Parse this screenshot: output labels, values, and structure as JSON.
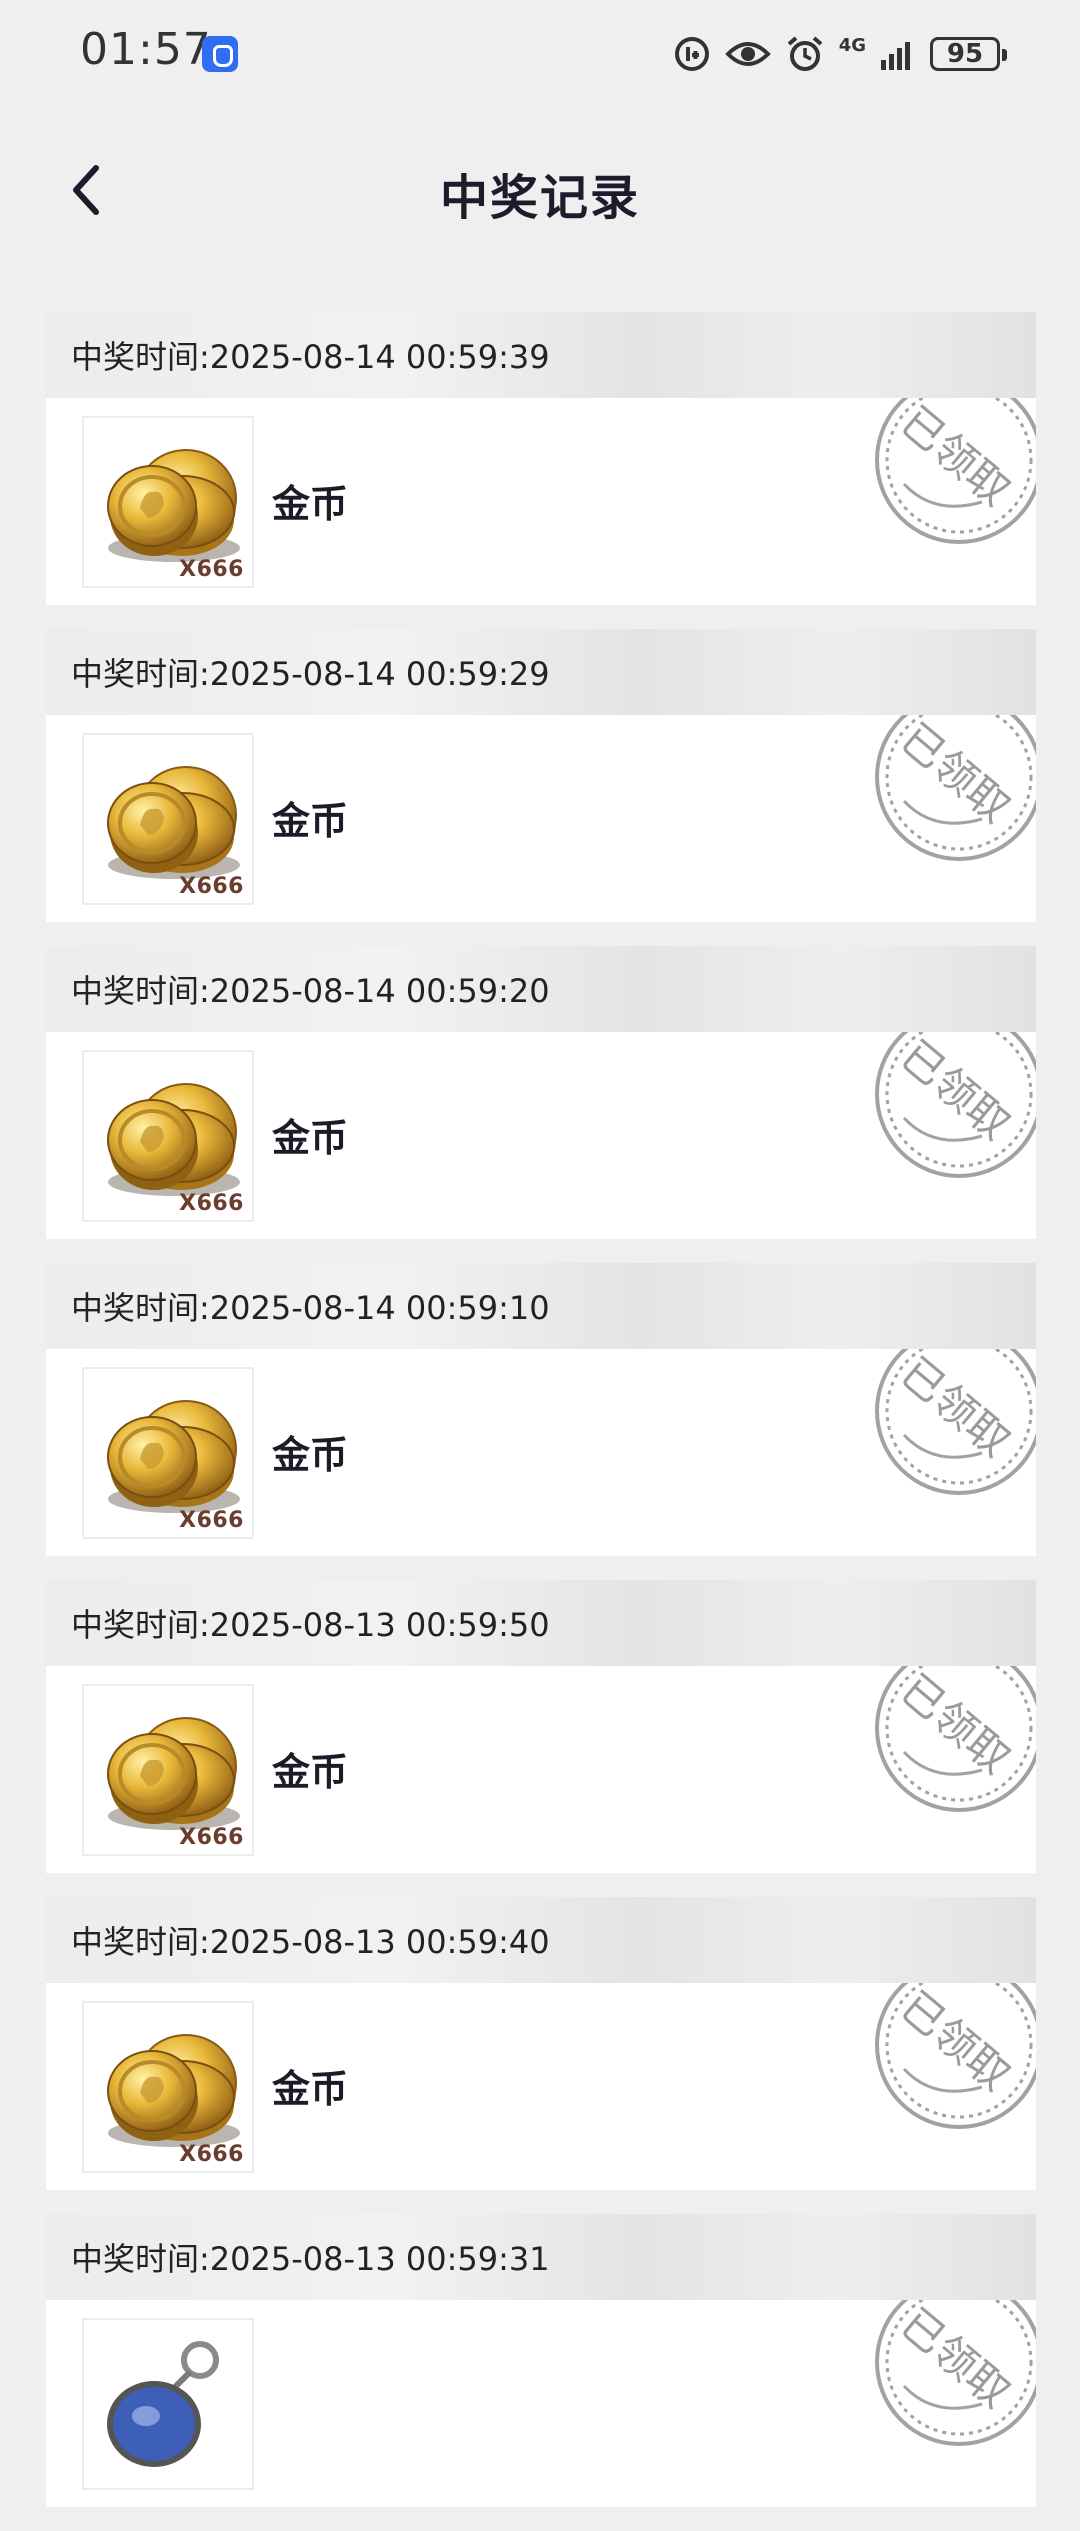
{
  "status_bar": {
    "time": "01:57",
    "network": "4G",
    "battery": "95",
    "icons": [
      "app-notification-icon",
      "data-saver-icon",
      "eye-comfort-icon",
      "alarm-icon",
      "signal-icon",
      "battery-icon"
    ]
  },
  "nav": {
    "title": "中奖记录",
    "back_icon": "chevron-left-icon"
  },
  "records": [
    {
      "time_text": "中奖时间:2025-08-14 00:59:39",
      "prize_name": "金币",
      "quantity": "X666",
      "prize_icon": "gold-coins-icon",
      "stamp": "已领取"
    },
    {
      "time_text": "中奖时间:2025-08-14 00:59:29",
      "prize_name": "金币",
      "quantity": "X666",
      "prize_icon": "gold-coins-icon",
      "stamp": "已领取"
    },
    {
      "time_text": "中奖时间:2025-08-14 00:59:20",
      "prize_name": "金币",
      "quantity": "X666",
      "prize_icon": "gold-coins-icon",
      "stamp": "已领取"
    },
    {
      "time_text": "中奖时间:2025-08-14 00:59:10",
      "prize_name": "金币",
      "quantity": "X666",
      "prize_icon": "gold-coins-icon",
      "stamp": "已领取"
    },
    {
      "time_text": "中奖时间:2025-08-13 00:59:50",
      "prize_name": "金币",
      "quantity": "X666",
      "prize_icon": "gold-coins-icon",
      "stamp": "已领取"
    },
    {
      "time_text": "中奖时间:2025-08-13 00:59:40",
      "prize_name": "金币",
      "quantity": "X666",
      "prize_icon": "gold-coins-icon",
      "stamp": "已领取"
    },
    {
      "time_text": "中奖时间:2025-08-13 00:59:31",
      "prize_name": "",
      "quantity": "",
      "prize_icon": "keychain-item-icon",
      "stamp": "已领取"
    }
  ],
  "colors": {
    "background": "#efefef",
    "card": "#ffffff",
    "stamp": "#9a9a9a",
    "coin_gold": "#e0b235",
    "quantity_text": "#6b3d2e"
  }
}
